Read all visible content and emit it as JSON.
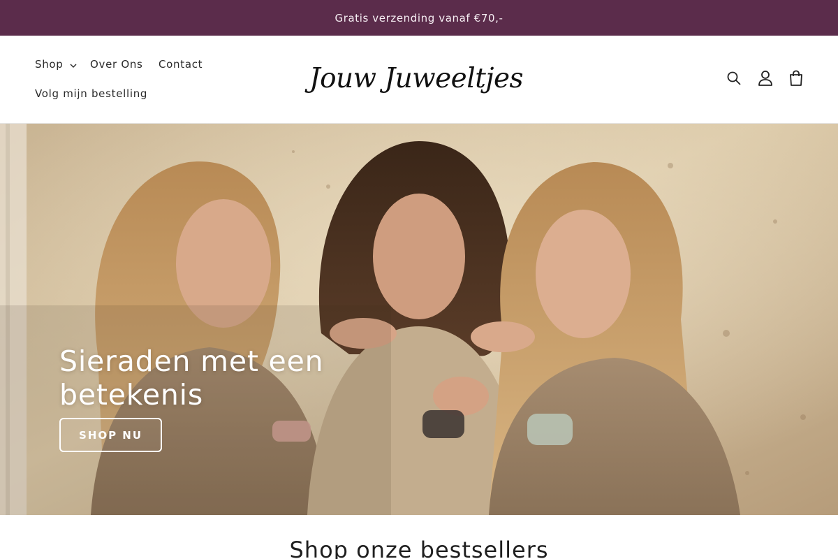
{
  "announcement": {
    "text": "Gratis verzending vanaf €70,-"
  },
  "header": {
    "nav": {
      "shop": "Shop",
      "over_ons": "Over Ons",
      "contact": "Contact",
      "volg": "Volg mijn bestelling"
    },
    "logo": "Jouw Juweeltjes",
    "icons": [
      "search-icon",
      "account-icon",
      "cart-icon"
    ]
  },
  "hero": {
    "title": "Sieraden met een betekenis",
    "button": "SHOP NU"
  },
  "bestsellers": {
    "title": "Shop onze bestsellers"
  },
  "colors": {
    "announcement_bg": "#5b2c4b",
    "hero_wall": "#cbb89a",
    "text": "#1f1f1f"
  }
}
